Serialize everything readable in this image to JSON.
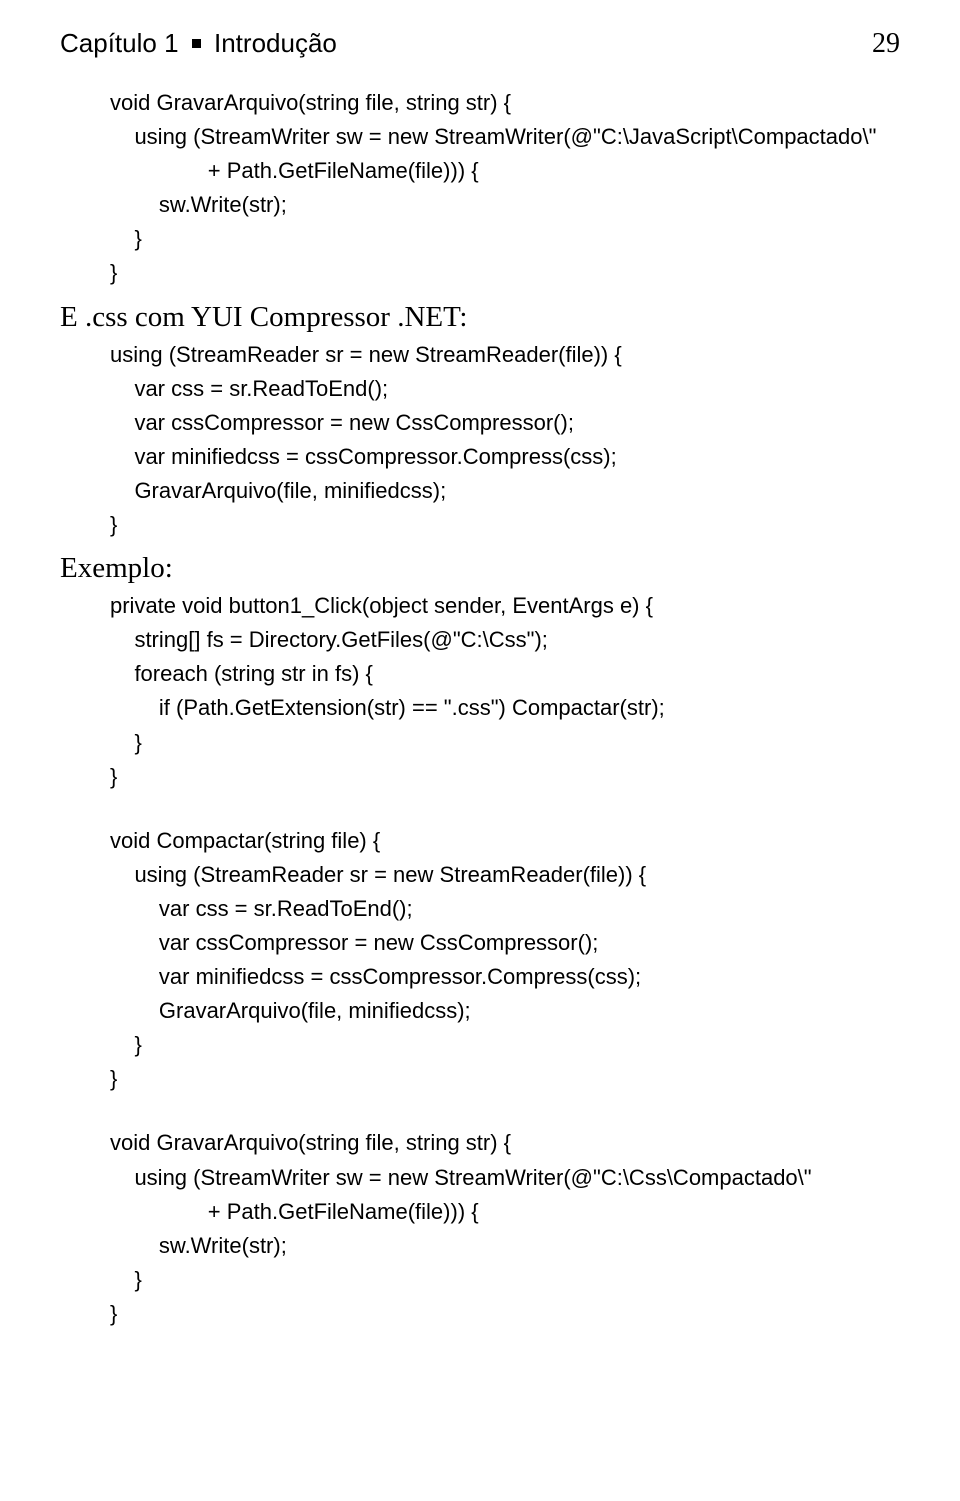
{
  "header": {
    "chapter_prefix": "Capítulo 1",
    "chapter_title": "Introdução",
    "page_number": "29"
  },
  "section_labels": {
    "css_yui": "E .css com YUI Compressor .NET:",
    "exemplo": "Exemplo:"
  },
  "code": {
    "block1": "void GravarArquivo(string file, string str) {\n    using (StreamWriter sw = new StreamWriter(@\"C:\\JavaScript\\Compactado\\\"\n                + Path.GetFileName(file))) {\n        sw.Write(str);\n    }\n}",
    "block2": "using (StreamReader sr = new StreamReader(file)) {\n    var css = sr.ReadToEnd();\n    var cssCompressor = new CssCompressor();\n    var minifiedcss = cssCompressor.Compress(css);\n    GravarArquivo(file, minifiedcss);\n}",
    "block3": "private void button1_Click(object sender, EventArgs e) {\n    string[] fs = Directory.GetFiles(@\"C:\\Css\");\n    foreach (string str in fs) {\n        if (Path.GetExtension(str) == \".css\") Compactar(str);\n    }\n}",
    "block4": "void Compactar(string file) {\n    using (StreamReader sr = new StreamReader(file)) {\n        var css = sr.ReadToEnd();\n        var cssCompressor = new CssCompressor();\n        var minifiedcss = cssCompressor.Compress(css);\n        GravarArquivo(file, minifiedcss);\n    }\n}",
    "block5": "void GravarArquivo(string file, string str) {\n    using (StreamWriter sw = new StreamWriter(@\"C:\\Css\\Compactado\\\"\n                + Path.GetFileName(file))) {\n        sw.Write(str);\n    }\n}"
  }
}
